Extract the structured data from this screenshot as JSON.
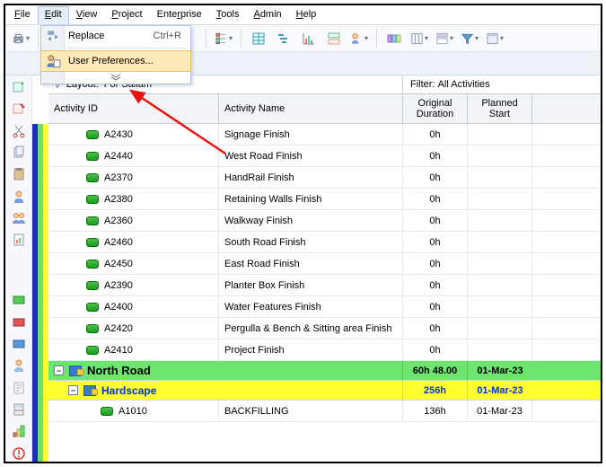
{
  "menubar": {
    "file": "File",
    "edit": "Edit",
    "view": "View",
    "project": "Project",
    "enterprise": "Enterprise",
    "tools": "Tools",
    "admin": "Admin",
    "help": "Help"
  },
  "edit_menu": {
    "replace": {
      "label": "Replace",
      "accel": "Ctrl+R"
    },
    "user_prefs": {
      "label": "User Preferences..."
    }
  },
  "layout": {
    "prefix": "Layout:",
    "name": "For Sallam"
  },
  "filter": {
    "prefix": "Filter:",
    "name": "All Activities"
  },
  "columns": {
    "activity_id": "Activity ID",
    "activity_name": "Activity Name",
    "original_duration": "Original Duration",
    "planned_start": "Planned Start"
  },
  "activities": [
    {
      "id": "A2430",
      "name": "Signage Finish",
      "dur": "0h",
      "start": ""
    },
    {
      "id": "A2440",
      "name": "West Road Finish",
      "dur": "0h",
      "start": ""
    },
    {
      "id": "A2370",
      "name": "HandRail Finish",
      "dur": "0h",
      "start": ""
    },
    {
      "id": "A2380",
      "name": "Retaining Walls Finish",
      "dur": "0h",
      "start": ""
    },
    {
      "id": "A2360",
      "name": "Walkway Finish",
      "dur": "0h",
      "start": ""
    },
    {
      "id": "A2460",
      "name": "South Road Finish",
      "dur": "0h",
      "start": ""
    },
    {
      "id": "A2450",
      "name": "East Road Finish",
      "dur": "0h",
      "start": ""
    },
    {
      "id": "A2390",
      "name": "Planter Box Finish",
      "dur": "0h",
      "start": ""
    },
    {
      "id": "A2400",
      "name": "Water Features Finish",
      "dur": "0h",
      "start": ""
    },
    {
      "id": "A2420",
      "name": "Pergulla  & Bench & Sitting area Finish",
      "dur": "0h",
      "start": ""
    },
    {
      "id": "A2410",
      "name": "Project Finish",
      "dur": "0h",
      "start": ""
    }
  ],
  "groups": {
    "north_road": {
      "label": "North Road",
      "dur": "60h 48.00",
      "start": "01-Mar-23"
    },
    "hardscape": {
      "label": "Hardscape",
      "dur": "256h",
      "start": "01-Mar-23"
    }
  },
  "sub_activity": {
    "id": "A1010",
    "name": "BACKFILLING",
    "dur": "136h",
    "start": "01-Mar-23"
  }
}
